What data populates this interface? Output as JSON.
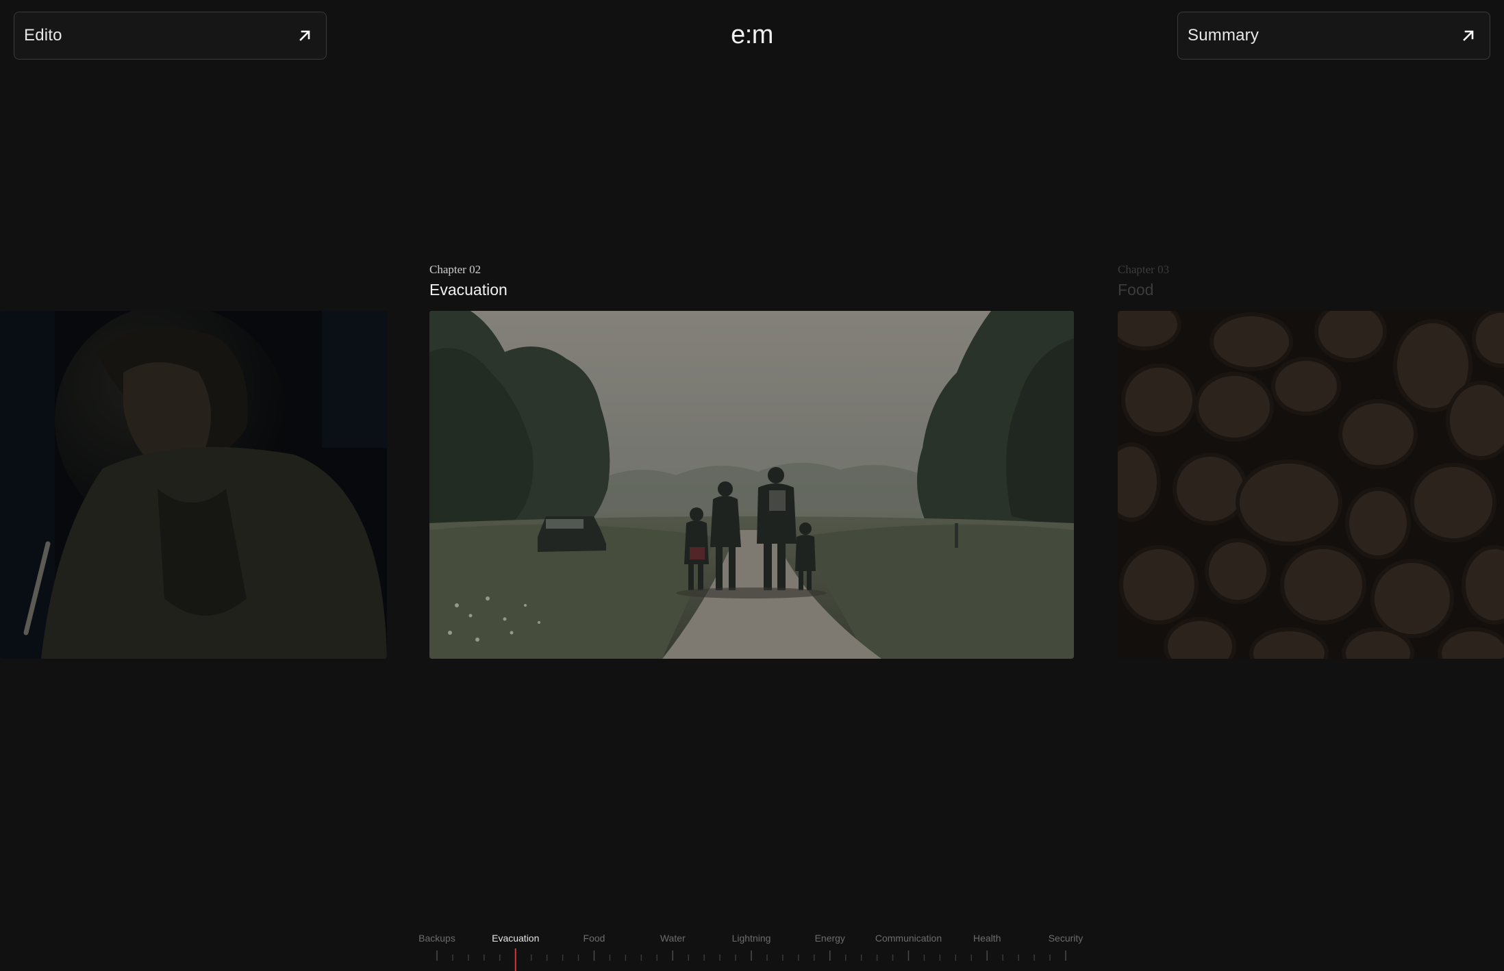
{
  "header": {
    "left_button": "Edito",
    "logo": "e:m",
    "right_button": "Summary"
  },
  "chapters": [
    {
      "number": "",
      "title": "",
      "image": "woman writing in dim light"
    },
    {
      "number": "Chapter 02",
      "title": "Evacuation",
      "image": "family walking on a country road"
    },
    {
      "number": "Chapter 03",
      "title": "Food",
      "image": "potatoes"
    }
  ],
  "timeline": {
    "items": [
      "Backups",
      "Evacuation",
      "Food",
      "Water",
      "Lightning",
      "Energy",
      "Communication",
      "Health",
      "Security"
    ],
    "active": "Evacuation",
    "progress_percent": 12.5
  },
  "colors": {
    "background": "#111111",
    "accent": "#d9363e",
    "text": "#e6e6e6",
    "muted": "#6d6d6d"
  },
  "icons": [
    "arrow-up-right-icon"
  ]
}
